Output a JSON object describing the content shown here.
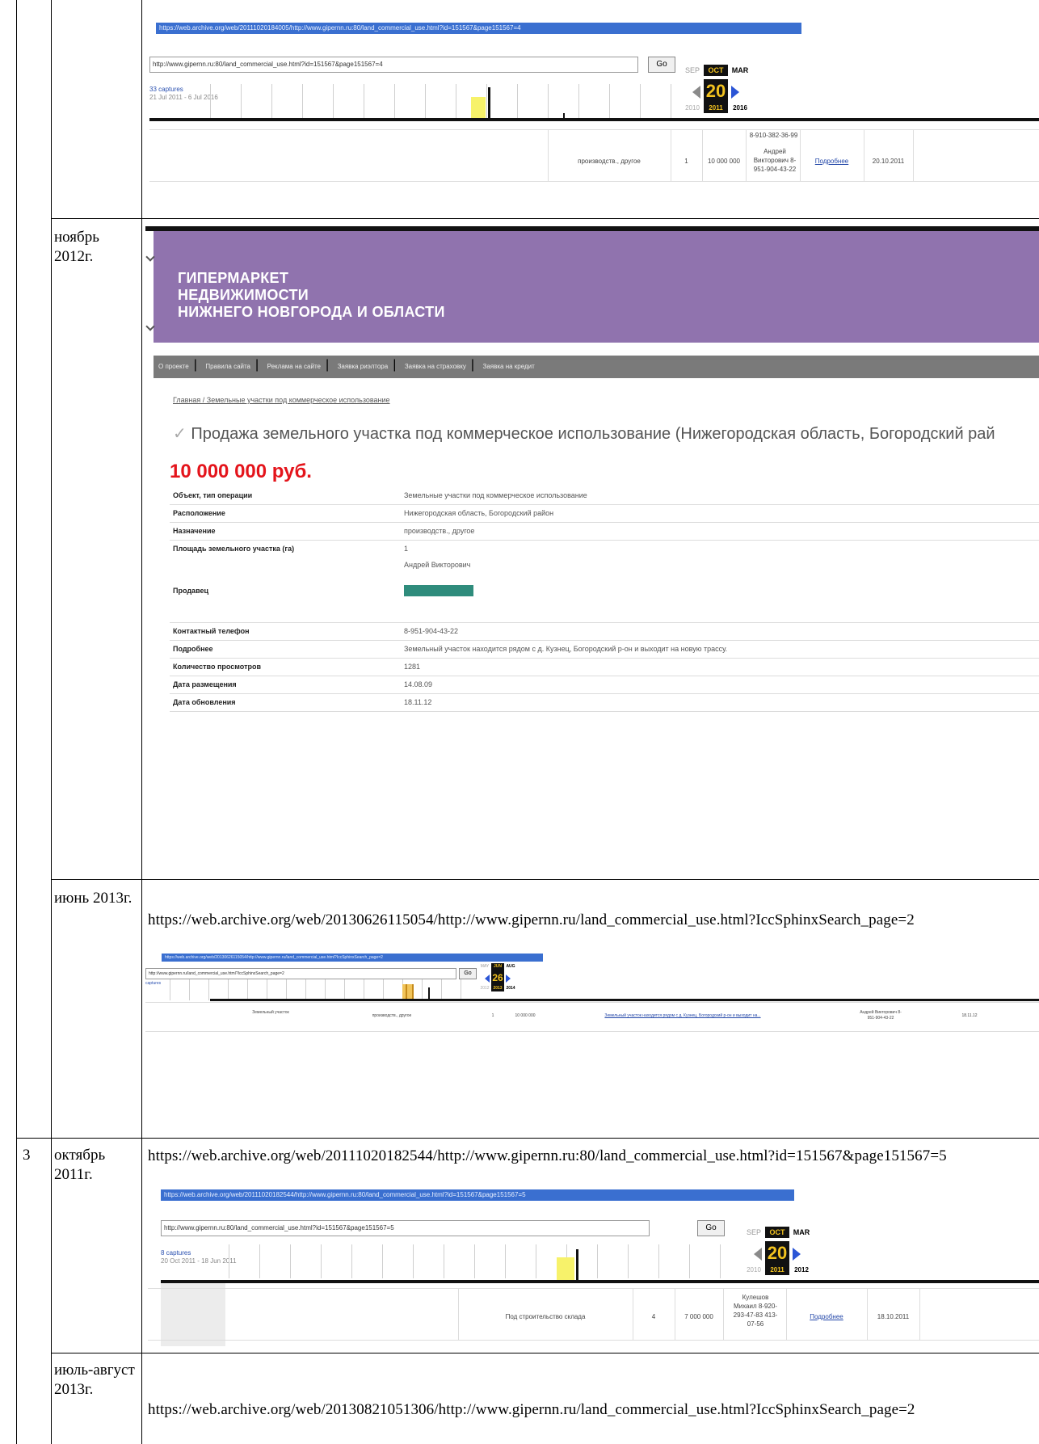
{
  "rows": [
    {
      "number": "",
      "date": "",
      "url": "",
      "wayback": {
        "address": "https://web.archive.org/web/20111020184005/http://www.gipernn.ru:80/land_commercial_use.html?id=151567&page151567=4",
        "input": "http://www.gipernn.ru:80/land_commercial_use.html?id=151567&page151567=4",
        "go": "Go",
        "captures": "33 captures",
        "range": "21 Jul 2011 - 6 Jul 2016",
        "months": [
          "SEP",
          "OCT",
          "MAR"
        ],
        "day": "20",
        "years": [
          "2010",
          "2011",
          "2016"
        ],
        "table": [
          "производств., другое",
          "1",
          "10 000 000",
          "Андрей Викторович 8-951-904-43-22",
          "Подробнее",
          "20.10.2011"
        ],
        "table_top": "8-910-382-36-99"
      }
    },
    {
      "number": "",
      "date": "ноябрь 2012г.",
      "url": "",
      "listing": {
        "brand": [
          "ГИПЕРМАРКЕТ",
          "НЕДВИЖИМОСТИ",
          "НИЖНЕГО НОВГОРОДА И ОБЛАСТИ"
        ],
        "nav": [
          "О проекте",
          "Правила сайта",
          "Реклама на сайте",
          "Заявка риэлтора",
          "Заявка на страховку",
          "Заявка на кредит"
        ],
        "breadcrumb": "Главная / Земельные участки под коммерческое использование",
        "title": "Продажа земельного участка под коммерческое использование (Нижегородская область, Богородский рай",
        "price": "10 000 000 руб.",
        "attributes": [
          {
            "key": "Объект, тип операции",
            "value": "Земельные участки под коммерческое использование"
          },
          {
            "key": "Расположение",
            "value": "Нижегородская область, Богородский район"
          },
          {
            "key": "Назначение",
            "value": "производств., другое"
          },
          {
            "key": "Площадь земельного участка (га)",
            "value": "1"
          },
          {
            "key": "Продавец",
            "value": "Андрей Викторович"
          },
          {
            "key": "Контактный телефон",
            "value": "8-951-904-43-22"
          },
          {
            "key": "Подробнее",
            "value": "Земельный участок находится рядом с д. Кузнец, Богородский р-он и выходит на новую трассу."
          },
          {
            "key": "Количество просмотров",
            "value": "1281"
          },
          {
            "key": "Дата размещения",
            "value": "14.08.09"
          },
          {
            "key": "Дата обновления",
            "value": "18.11.12"
          }
        ]
      }
    },
    {
      "number": "",
      "date": "июнь 2013г.",
      "url": "https://web.archive.org/web/20130626115054/http://www.gipernn.ru/land_commercial_use.html?IccSphinxSearch_page=2",
      "wayback": {
        "address": "https://web.archive.org/web/20130626115054/http://www.gipernn.ru/land_commercial_use.html?IccSphinxSearch_page=2",
        "input": "http://www.gipernn.ru/land_commercial_use.html?IccSphinxSearch_page=2",
        "go": "Go",
        "captures": "captures",
        "range": "",
        "months": [
          "MAY",
          "JUN",
          "AUG"
        ],
        "day": "26",
        "years": [
          "2012",
          "2013",
          "2014"
        ],
        "table": [
          "Земельный участок",
          "производств., другое",
          "1",
          "10 000 000",
          "Земельный участок находится рядом с д. Кузнец, Богородский р-он и выходит на...",
          "Андрей Викторович 8-951-904-43-22",
          "18.11.12"
        ],
        "table_top": ""
      }
    },
    {
      "number": "3",
      "date": "октябрь 2011г.",
      "url": "https://web.archive.org/web/20111020182544/http://www.gipernn.ru:80/land_commercial_use.html?id=151567&page151567=5",
      "wayback": {
        "address": "https://web.archive.org/web/20111020182544/http://www.gipernn.ru:80/land_commercial_use.html?id=151567&page151567=5",
        "input": "http://www.gipernn.ru:80/land_commercial_use.html?id=151567&page151567=5",
        "go": "Go",
        "captures": "8 captures",
        "range": "20 Oct 2011 - 18 Jun 2011",
        "months": [
          "SEP",
          "OCT",
          "MAR"
        ],
        "day": "20",
        "years": [
          "2010",
          "2011",
          "2012"
        ],
        "table": [
          "Под строительство склада",
          "4",
          "7 000 000",
          "Кулешов Михаил 8-920-293-47-83 413-07-56",
          "Подробнее",
          "18.10.2011"
        ],
        "table_top": ""
      }
    },
    {
      "number": "",
      "date": "июль-август 2013г.",
      "url": "https://web.archive.org/web/20130821051306/http://www.gipernn.ru/land_commercial_use.html?IccSphinxSearch_page=2"
    }
  ]
}
